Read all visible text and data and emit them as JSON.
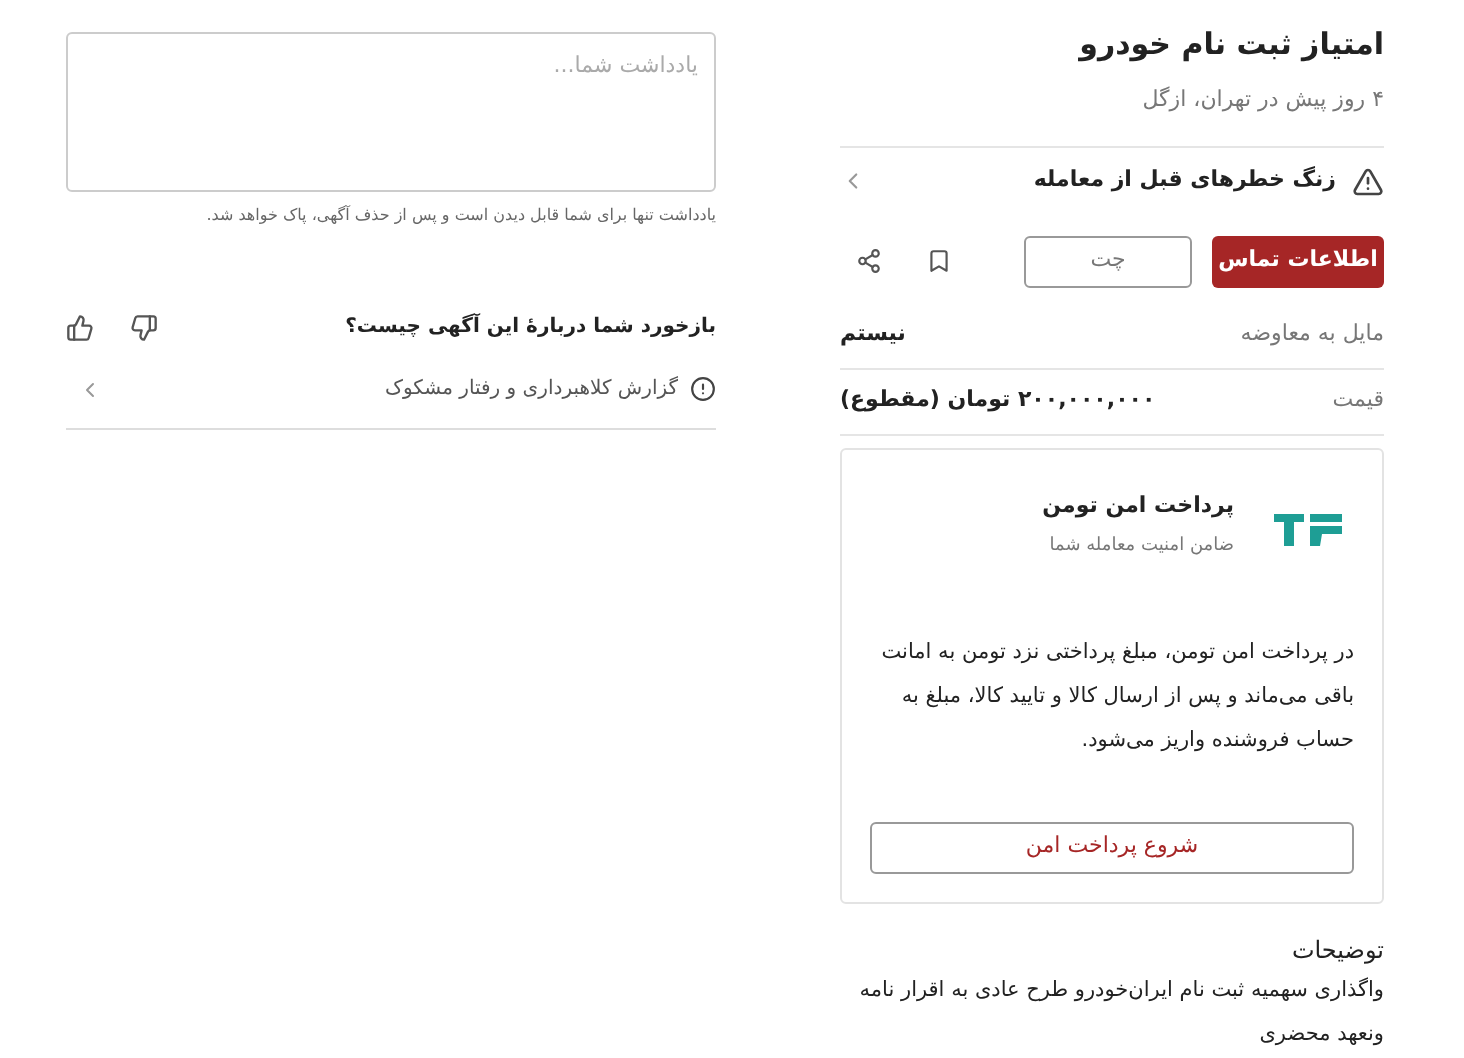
{
  "ad": {
    "title": "امتیاز ثبت نام خودرو",
    "subtitle": "۴ روز پیش در تهران، ازگل"
  },
  "alert": {
    "text": "زنگ خطرهای قبل از معامله"
  },
  "actions": {
    "contact": "اطلاعات تماس",
    "chat": "چت"
  },
  "attributes": [
    {
      "label": "مایل به معاوضه",
      "value": "نیستم"
    },
    {
      "label": "قیمت",
      "value": "۲۰۰,۰۰۰,۰۰۰ تومان (مقطوع)"
    }
  ],
  "secure_payment": {
    "title": "پرداخت امن تومن",
    "subtitle": "ضامن امنیت معامله شما",
    "description": "در پرداخت امن تومن، مبلغ پرداختی نزد تومن به امانت باقی می‌ماند و پس از ارسال کالا و تایید کالا، مبلغ به حساب فروشنده واریز می‌شود.",
    "button": "شروع پرداخت امن"
  },
  "description": {
    "heading": "توضیحات",
    "lines": [
      "واگذاری سهمیه ثبت نام ایران‌خودرو طرح عادی به اقرار نامه",
      "ونعهد محضری"
    ]
  },
  "note": {
    "placeholder": "یادداشت شما...",
    "hint": "یادداشت تنها برای شما قابل دیدن است و پس از حذف آگهی، پاک خواهد شد."
  },
  "feedback": {
    "question": "بازخورد شما دربارهٔ این آگهی چیست؟"
  },
  "report": {
    "text": "گزارش کلاهبرداری و رفتار مشکوک"
  }
}
